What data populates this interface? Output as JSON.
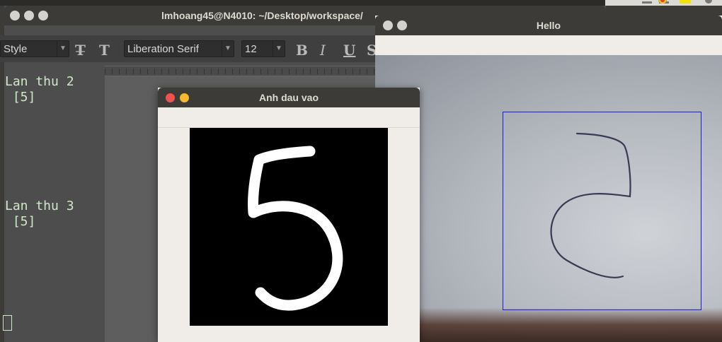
{
  "terminal": {
    "title": "lmhoang45@N4010: ~/Desktop/workspace/",
    "lines": [
      "Lan thu 2",
      " [5]",
      "Lan thu 3",
      " [5]"
    ]
  },
  "writer": {
    "style_value": "Style",
    "font_value": "Liberation Serif",
    "size_value": "12",
    "toolbar_icons": [
      "clear-formatting-icon",
      "char-style-icon",
      "bold-icon",
      "italic-icon",
      "underline-icon",
      "strikethrough-icon"
    ]
  },
  "hello_window": {
    "title": "Hello",
    "roi_color": "#1a1ae0"
  },
  "input_window": {
    "title": "Anh dau vao"
  },
  "colors": {
    "titlebar": "#3c3b37",
    "close": "#ef5350",
    "minimize": "#f5b82e"
  }
}
